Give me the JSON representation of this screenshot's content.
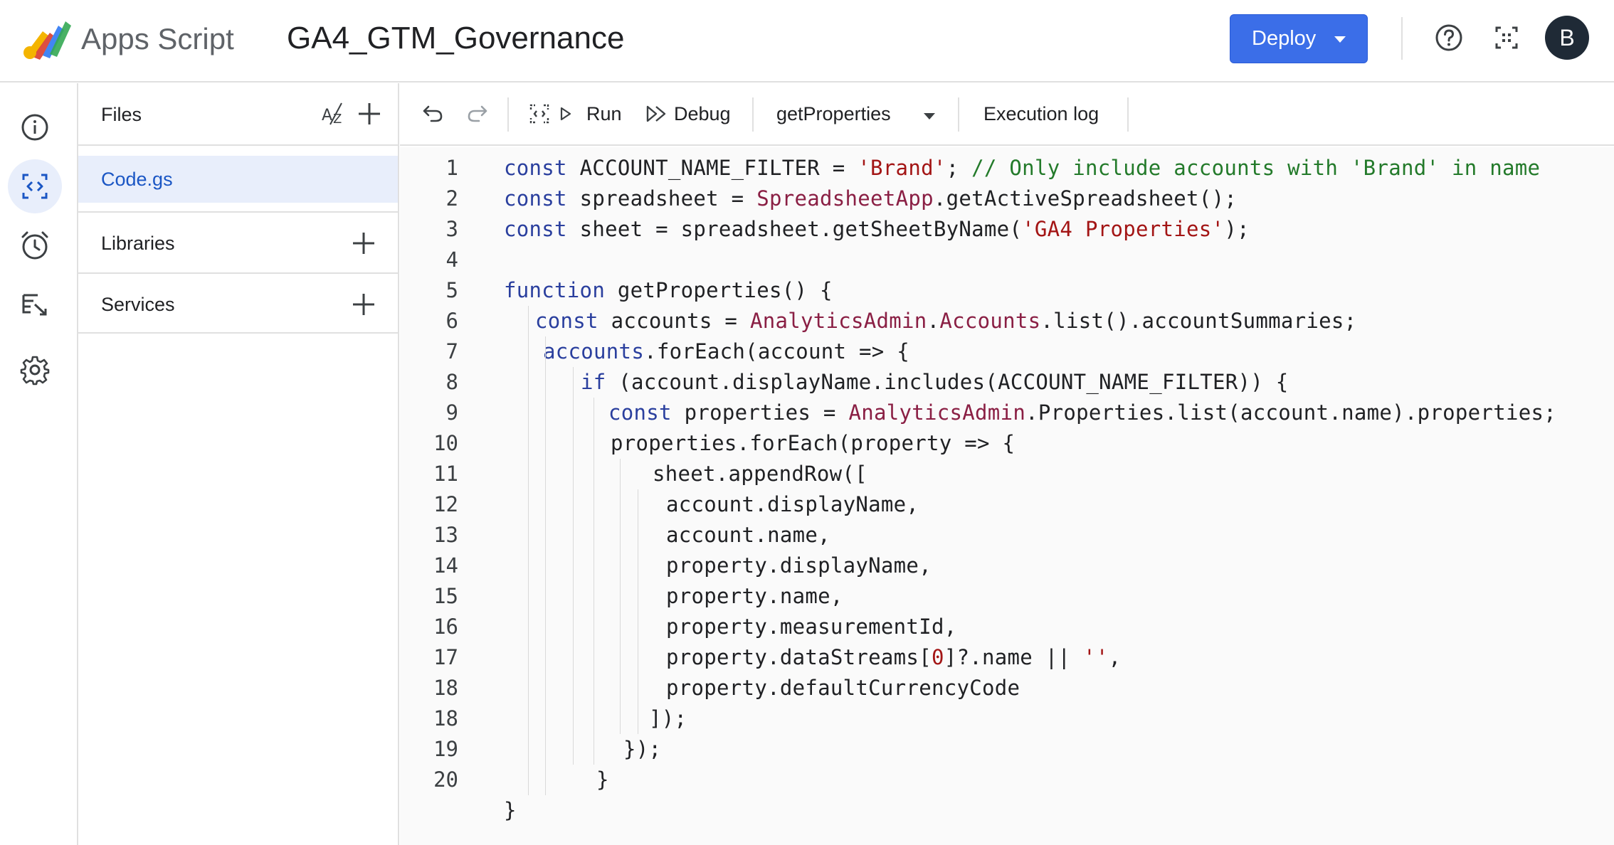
{
  "header": {
    "app_name": "Apps Script",
    "project_title": "GA4_GTM_Governance",
    "deploy_label": "Deploy",
    "avatar_initial": "B"
  },
  "rail": {
    "items": [
      {
        "icon": "info-icon",
        "active": false
      },
      {
        "icon": "code-editor-icon",
        "active": true
      },
      {
        "icon": "clock-icon",
        "active": false
      },
      {
        "icon": "executions-icon",
        "active": false
      },
      {
        "icon": "gear-icon",
        "active": false
      }
    ]
  },
  "files": {
    "header_label": "Files",
    "items": [
      {
        "name": "Code.gs",
        "selected": true
      }
    ],
    "sections": [
      {
        "label": "Libraries"
      },
      {
        "label": "Services"
      }
    ]
  },
  "toolbar": {
    "run_label": "Run",
    "debug_label": "Debug",
    "function_select": "getProperties",
    "execution_log_label": "Execution log"
  },
  "colors": {
    "accent": "#3b6ee8",
    "selected_bg": "#e8eefb",
    "keyword": "#2a3f9e",
    "string": "#a31515",
    "comment": "#237a2a",
    "class_ref": "#8a1f44"
  },
  "code": {
    "lines": [
      {
        "n": "1",
        "indent": 0,
        "tokens": [
          {
            "t": "kw",
            "v": "const"
          },
          {
            "t": "p",
            "v": " ACCOUNT_NAME_FILTER = "
          },
          {
            "t": "str",
            "v": "'Brand'"
          },
          {
            "t": "p",
            "v": "; "
          },
          {
            "t": "cmt",
            "v": "// Only include accounts with 'Brand' in name"
          }
        ]
      },
      {
        "n": "2",
        "indent": 0,
        "tokens": [
          {
            "t": "kw",
            "v": "const"
          },
          {
            "t": "p",
            "v": " spreadsheet = "
          },
          {
            "t": "cls",
            "v": "SpreadsheetApp"
          },
          {
            "t": "p",
            "v": ".getActiveSpreadsheet();"
          }
        ]
      },
      {
        "n": "3",
        "indent": 0,
        "tokens": [
          {
            "t": "kw",
            "v": "const"
          },
          {
            "t": "p",
            "v": " sheet = spreadsheet.getSheetByName("
          },
          {
            "t": "str",
            "v": "'GA4 Properties'"
          },
          {
            "t": "p",
            "v": ");"
          }
        ]
      },
      {
        "n": "4",
        "indent": 0,
        "tokens": []
      },
      {
        "n": "5",
        "indent": 0,
        "tokens": [
          {
            "t": "kw",
            "v": "function"
          },
          {
            "t": "p",
            "v": " getProperties() {"
          }
        ]
      },
      {
        "n": "6",
        "indent": 1,
        "tokens": [
          {
            "t": "kw",
            "v": "const"
          },
          {
            "t": "p",
            "v": " accounts = "
          },
          {
            "t": "cls",
            "v": "AnalyticsAdmin"
          },
          {
            "t": "p",
            "v": "."
          },
          {
            "t": "cls",
            "v": "Accounts"
          },
          {
            "t": "p",
            "v": ".list().accountSummaries;"
          }
        ]
      },
      {
        "n": "7",
        "indent": 2,
        "tokens": [
          {
            "t": "kw",
            "v": "accounts"
          },
          {
            "t": "p",
            "v": ".forEach(account => {"
          }
        ]
      },
      {
        "n": "8",
        "indent": 3,
        "tokens": [
          {
            "t": "kw",
            "v": "if"
          },
          {
            "t": "p",
            "v": " (account.displayName.includes(ACCOUNT_NAME_FILTER)) {"
          }
        ]
      },
      {
        "n": "9",
        "indent": 4,
        "tokens": [
          {
            "t": "kw",
            "v": "const"
          },
          {
            "t": "p",
            "v": " properties = "
          },
          {
            "t": "cls",
            "v": "AnalyticsAdmin"
          },
          {
            "t": "p",
            "v": ".Properties.list(account.name).properties;"
          }
        ]
      },
      {
        "n": "10",
        "indent": 5,
        "tokens": [
          {
            "t": "p",
            "v": "properties.forEach(property => {"
          }
        ]
      },
      {
        "n": "11",
        "indent": 6,
        "tokens": [
          {
            "t": "p",
            "v": "sheet.appendRow(["
          }
        ]
      },
      {
        "n": "12",
        "indent": 7,
        "tokens": [
          {
            "t": "p",
            "v": "account.displayName,"
          }
        ]
      },
      {
        "n": "13",
        "indent": 7,
        "tokens": [
          {
            "t": "p",
            "v": "account.name,"
          }
        ]
      },
      {
        "n": "14",
        "indent": 7,
        "tokens": [
          {
            "t": "p",
            "v": "property.displayName,"
          }
        ]
      },
      {
        "n": "15",
        "indent": 7,
        "tokens": [
          {
            "t": "p",
            "v": "property.name,"
          }
        ]
      },
      {
        "n": "16",
        "indent": 7,
        "tokens": [
          {
            "t": "p",
            "v": "property.measurementId,"
          }
        ]
      },
      {
        "n": "17",
        "indent": 7,
        "tokens": [
          {
            "t": "p",
            "v": "property.dataStreams["
          },
          {
            "t": "num",
            "v": "0"
          },
          {
            "t": "p",
            "v": "]?.name || "
          },
          {
            "t": "str",
            "v": "''"
          },
          {
            "t": "p",
            "v": ","
          }
        ]
      },
      {
        "n": "18",
        "indent": 7,
        "tokens": [
          {
            "t": "p",
            "v": "property.defaultCurrencyCode"
          }
        ]
      },
      {
        "n": "18",
        "indent": 8,
        "tokens": [
          {
            "t": "p",
            "v": "]);"
          }
        ]
      },
      {
        "n": "19",
        "indent": 9,
        "tokens": [
          {
            "t": "p",
            "v": "});"
          }
        ]
      },
      {
        "n": "20",
        "indent": 10,
        "tokens": [
          {
            "t": "p",
            "v": "}"
          }
        ]
      },
      {
        "n": "",
        "indent": 0,
        "tokens": [
          {
            "t": "p",
            "v": "}"
          }
        ]
      }
    ]
  }
}
